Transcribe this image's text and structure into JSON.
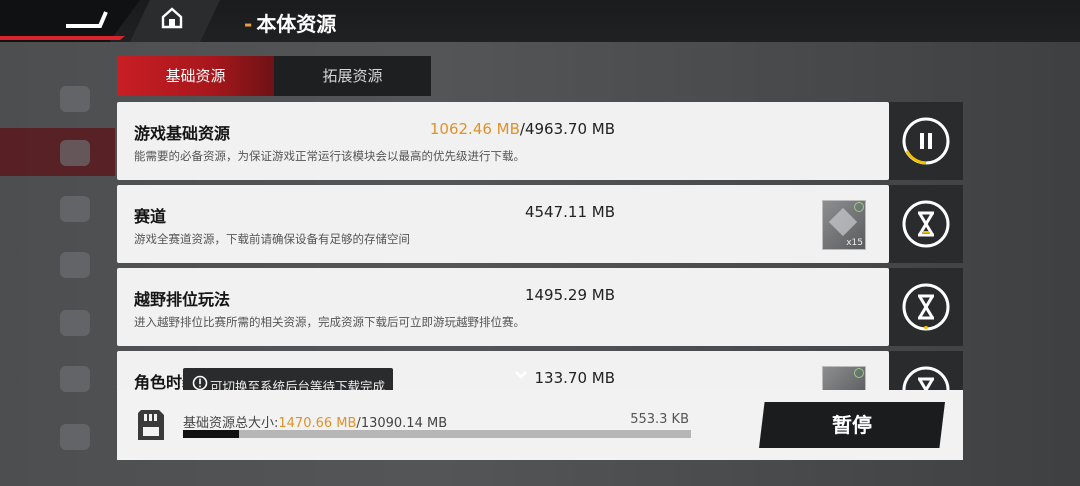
{
  "header": {
    "title_dash": "-",
    "title": "本体资源"
  },
  "tabs": [
    {
      "label": "基础资源",
      "active": true
    },
    {
      "label": "拓展资源",
      "active": false
    }
  ],
  "resources": [
    {
      "title": "游戏基础资源",
      "downloaded": "1062.46 MB",
      "separator": "/",
      "total": "4963.70 MB",
      "description": "能需要的必备资源，为保证游戏正常运行该模块会以最高的优先级进行下载。",
      "control": "pause-icon",
      "progress": 0.21
    },
    {
      "title": "赛道",
      "total": "4547.11 MB",
      "description": "游戏全赛道资源，下载前请确保设备有足够的存储空间",
      "control": "hourglass-icon",
      "thumb_multiplier": "x15"
    },
    {
      "title": "越野排位玩法",
      "total": "1495.29 MB",
      "description": "进入越野排位比赛所需的相关资源，完成资源下载后可立即游玩越野排位赛。",
      "control": "hourglass-icon"
    },
    {
      "title": "角色时装资源",
      "total": "133.70 MB",
      "description": "",
      "control": "hourglass-icon"
    }
  ],
  "tooltip": {
    "icon": "info-icon",
    "text": "可切换至系统后台等待下载完成"
  },
  "footer": {
    "total_label": "基础资源总大小:",
    "downloaded": "1470.66 MB",
    "separator": "/",
    "total": "13090.14 MB",
    "speed": "553.3 KB",
    "progress": 0.11,
    "pause_label": "暂停"
  },
  "colors": {
    "accent": "#d8242a",
    "progress_text": "#e0922a"
  }
}
